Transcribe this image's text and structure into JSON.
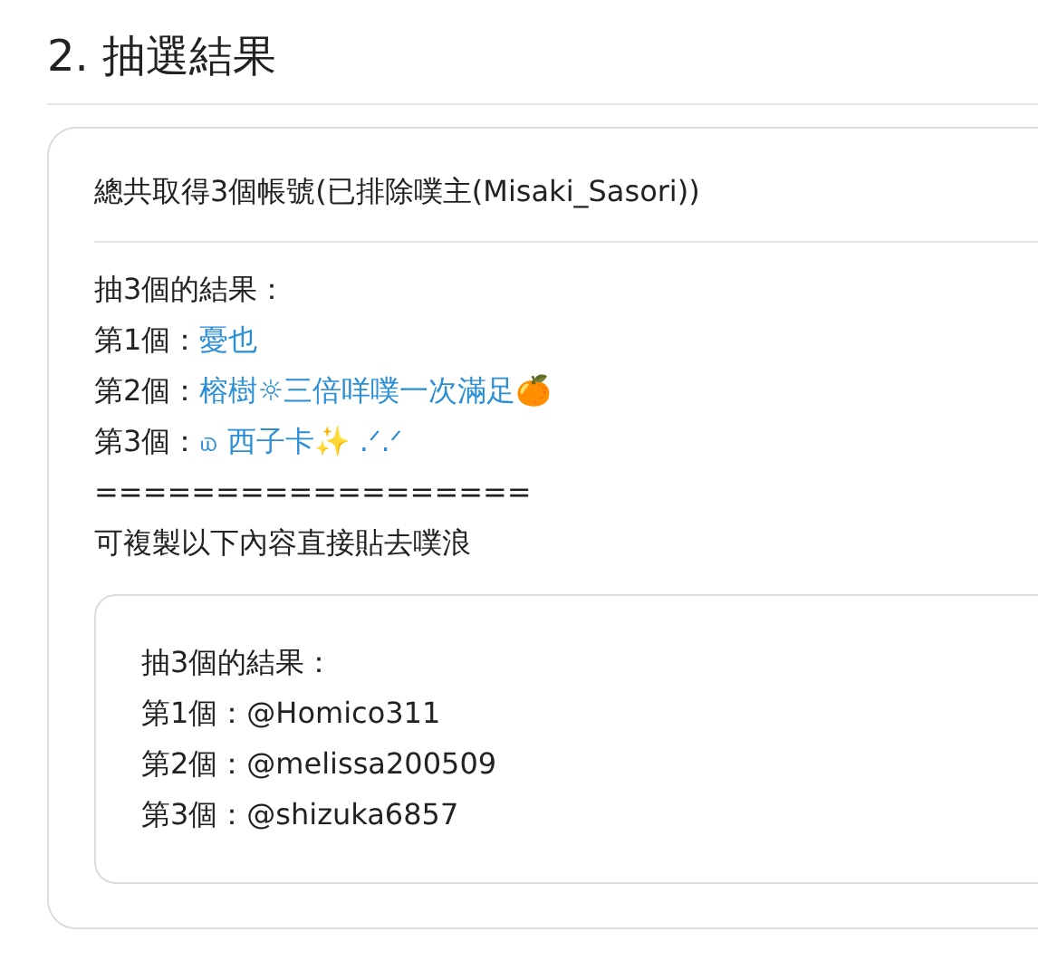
{
  "heading": "2. 抽選結果",
  "summary": "總共取得3個帳號(已排除噗主(Misaki_Sasori))",
  "result_title": "抽3個的結果：",
  "winners": [
    {
      "label": "第1個：",
      "name": "憂也"
    },
    {
      "label": "第2個：",
      "name": "榕樹☼三倍咩噗一次滿足🍊"
    },
    {
      "label": "第3個：",
      "name": "௰ 西子卡✨ .ᐟ.ᐟ"
    }
  ],
  "divider": "==================",
  "copy_hint": "可複製以下內容直接貼去噗浪",
  "copy_box": {
    "lines": [
      "抽3個的結果：",
      "第1個：@Homico311",
      "第2個：@melissa200509",
      "第3個：@shizuka6857"
    ]
  }
}
